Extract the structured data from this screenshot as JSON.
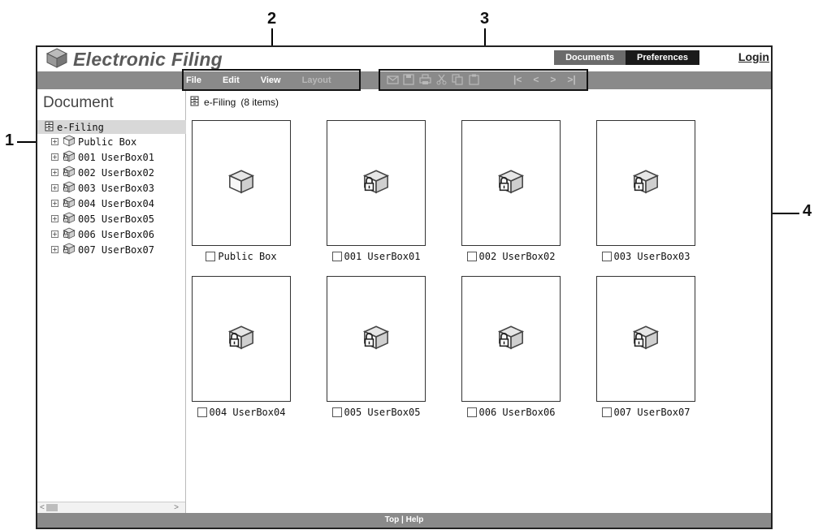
{
  "callouts": {
    "c1": "1",
    "c2": "2",
    "c3": "3",
    "c4": "4"
  },
  "app": {
    "title": "Electronic Filing"
  },
  "nav": {
    "documents": "Documents",
    "preferences": "Preferences",
    "login": "Login"
  },
  "menu": {
    "file": "File",
    "edit": "Edit",
    "view": "View",
    "layout": "Layout"
  },
  "toolbar": {
    "icons": [
      "mail-icon",
      "save-icon",
      "print-icon",
      "cut-icon",
      "copy-icon",
      "paste-icon"
    ],
    "nav": {
      "first": "|<",
      "prev": "<",
      "next": ">",
      "last": ">|"
    }
  },
  "sidebar": {
    "title": "Document",
    "root": "e-Filing",
    "items": [
      {
        "label": "Public Box",
        "locked": false
      },
      {
        "label": "001 UserBox01",
        "locked": true
      },
      {
        "label": "002 UserBox02",
        "locked": true
      },
      {
        "label": "003 UserBox03",
        "locked": true
      },
      {
        "label": "004 UserBox04",
        "locked": true
      },
      {
        "label": "005 UserBox05",
        "locked": true
      },
      {
        "label": "006 UserBox06",
        "locked": true
      },
      {
        "label": "007 UserBox07",
        "locked": true
      }
    ]
  },
  "main": {
    "breadcrumb": "e-Filing",
    "count": "(8 items)",
    "boxes": [
      {
        "label": "Public Box",
        "locked": false
      },
      {
        "label": "001 UserBox01",
        "locked": true
      },
      {
        "label": "002 UserBox02",
        "locked": true
      },
      {
        "label": "003 UserBox03",
        "locked": true
      },
      {
        "label": "004 UserBox04",
        "locked": true
      },
      {
        "label": "005 UserBox05",
        "locked": true
      },
      {
        "label": "006 UserBox06",
        "locked": true
      },
      {
        "label": "007 UserBox07",
        "locked": true
      }
    ]
  },
  "footer": {
    "top": "Top",
    "sep": "|",
    "help": "Help"
  }
}
